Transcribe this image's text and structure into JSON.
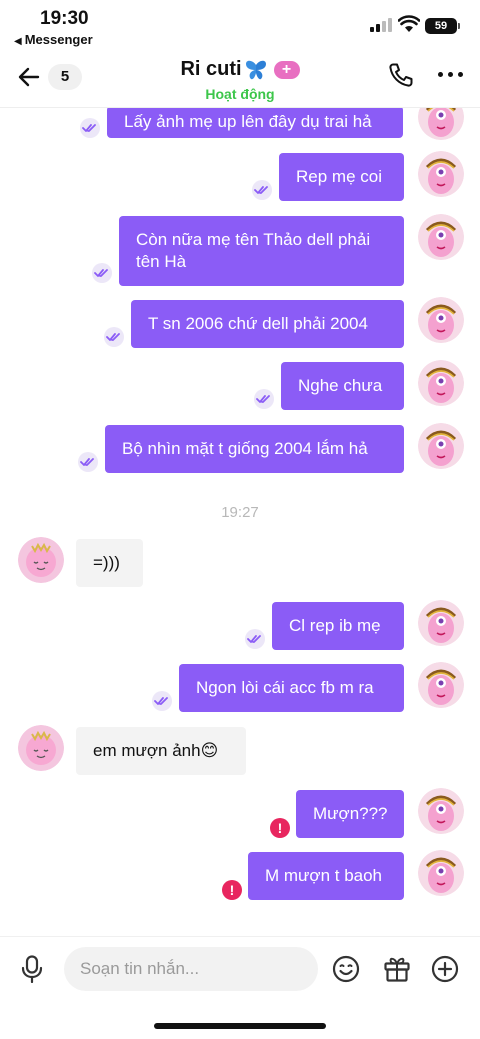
{
  "status_bar": {
    "time": "19:30",
    "back_app": "Messenger",
    "battery": "59"
  },
  "header": {
    "unread_count": "5",
    "name": "Ri cuti",
    "status": "Hoạt động",
    "plus_label": "+"
  },
  "messages": [
    {
      "text": "Lấy ảnh mẹ up lên đây dụ trai hả",
      "dir": "out"
    },
    {
      "text": "Rep mẹ coi",
      "dir": "out"
    },
    {
      "text": "Còn nữa mẹ tên Thảo dell phải tên Hà",
      "dir": "out"
    },
    {
      "text": "T sn 2006 chứ dell phải 2004",
      "dir": "out"
    },
    {
      "text": "Nghe chưa",
      "dir": "out"
    },
    {
      "text": "Bộ nhìn mặt t giống 2004 lắm hả",
      "dir": "out"
    },
    {
      "text": "=)))",
      "dir": "in"
    },
    {
      "text": "Cl rep ib mẹ",
      "dir": "out"
    },
    {
      "text": "Ngon lòi cái acc fb m ra",
      "dir": "out"
    },
    {
      "text": "em mượn ảnh😊",
      "dir": "in"
    },
    {
      "text": "Mượn???",
      "dir": "out",
      "failed": true
    },
    {
      "text": "M mượn t baoh",
      "dir": "out",
      "failed": true
    }
  ],
  "timestamp": "19:27",
  "composer": {
    "placeholder": "Soạn tin nhắn..."
  },
  "colors": {
    "outgoing_bubble": "#8b5cf6",
    "incoming_bubble": "#f3f3f3",
    "active_green": "#3cc64a",
    "error_red": "#e8265f"
  },
  "icons": [
    "back-arrow-icon",
    "butterfly-icon",
    "phone-icon",
    "more-icon",
    "seen-check-icon",
    "error-icon",
    "mic-icon",
    "emoji-icon",
    "gift-icon",
    "add-icon"
  ]
}
